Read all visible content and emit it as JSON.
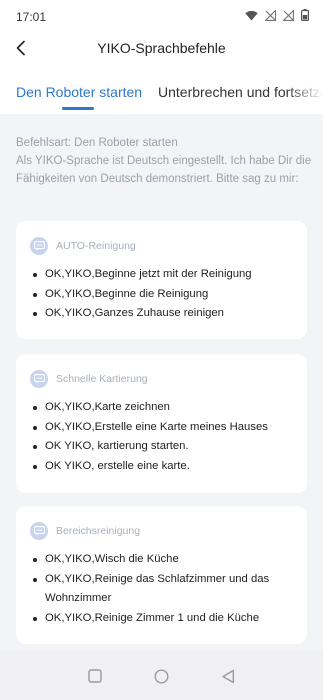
{
  "status_bar": {
    "time": "17:01",
    "icons": [
      "wifi-icon",
      "signal-off-icon",
      "signal-off-icon",
      "battery-icon"
    ]
  },
  "header": {
    "title": "YIKO-Sprachbefehle",
    "back_icon": "chevron-left-icon"
  },
  "tabs": [
    {
      "label": "Den Roboter starten",
      "active": true
    },
    {
      "label": "Unterbrechen und fortsetzen",
      "active": false
    }
  ],
  "intro": {
    "line1": "Befehlsart: Den Roboter starten",
    "line2": "Als YIKO-Sprache ist Deutsch eingestellt. Ich habe Dir die Fähigkeiten von Deutsch demonstriert. Bitte sag zu mir:"
  },
  "cards": [
    {
      "title": "AUTO-Reinigung",
      "icon": "chat-bubble-icon",
      "commands": [
        "OK,YIKO,Beginne jetzt mit der Reinigung",
        "OK,YIKO,Beginne die Reinigung",
        "OK,YIKO,Ganzes Zuhause reinigen"
      ]
    },
    {
      "title": "Schnelle Kartierung",
      "icon": "chat-bubble-icon",
      "commands": [
        "OK,YIKO,Karte zeichnen",
        "OK,YIKO,Erstelle eine Karte meines Hauses",
        "OK YIKO, kartierung starten.",
        "OK YIKO, erstelle eine karte."
      ]
    },
    {
      "title": "Bereichsreinigung",
      "icon": "chat-bubble-icon",
      "commands": [
        "OK,YIKO,Wisch die Küche",
        "OK,YIKO,Reinige das Schlafzimmer und das Wohnzimmer",
        "OK,YIKO,Reinige Zimmer 1 und die Küche"
      ]
    }
  ],
  "nav_bar": {
    "buttons": [
      "recents-square-icon",
      "home-circle-icon",
      "back-triangle-icon"
    ]
  },
  "colors": {
    "accent": "#2e78c9",
    "background": "#f3f4f7",
    "card": "#ffffff",
    "muted_text": "#9aa1ab"
  }
}
